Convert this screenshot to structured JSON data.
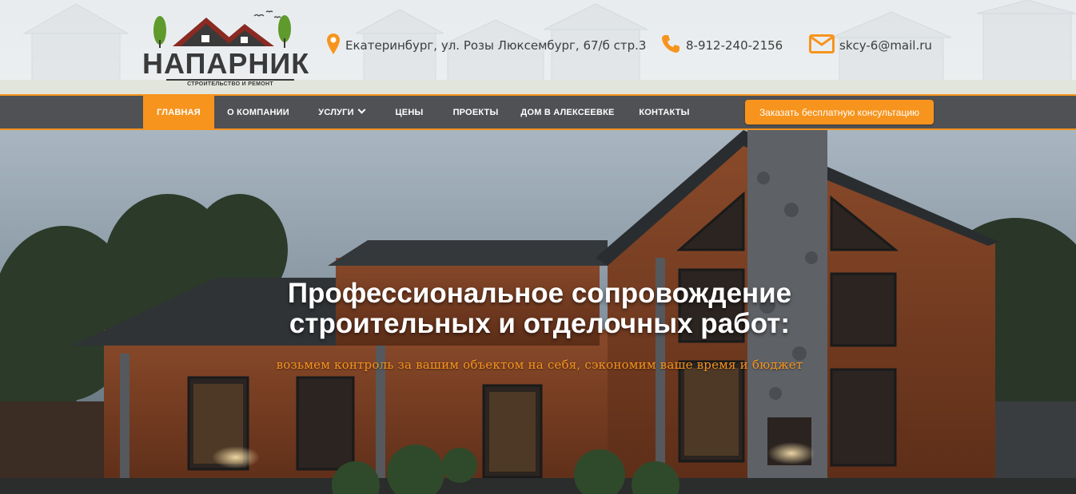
{
  "brand": {
    "name": "НАПАРНИК",
    "tagline": "СТРОИТЕЛЬСТВО И РЕМОНТ"
  },
  "contacts": {
    "address": "Екатеринбург, ул. Розы Люксембург, 67/б стр.3",
    "phone": "8-912-240-2156",
    "email": "skcy-6@mail.ru",
    "icons": {
      "address": "map-pin-icon",
      "phone": "phone-icon",
      "email": "envelope-icon"
    }
  },
  "nav": {
    "items": [
      {
        "label": "ГЛАВНАЯ",
        "active": true
      },
      {
        "label": "О КОМПАНИИ"
      },
      {
        "label": "УСЛУГИ",
        "dropdown": true
      },
      {
        "label": "ЦЕНЫ"
      },
      {
        "label": "ПРОЕКТЫ"
      },
      {
        "label": "ДОМ В АЛЕКСЕЕВКЕ"
      },
      {
        "label": "КОНТАКТЫ"
      }
    ],
    "cta_label": "Заказать бесплатную консультацию"
  },
  "hero": {
    "title_line1": "Профессиональное сопровождение",
    "title_line2": "строительных и отделочных работ:",
    "subtitle": "возьмем контроль за вашим объектом на себя, сэкономим ваше время и бюджет"
  },
  "colors": {
    "accent": "#f7941d",
    "nav_bg": "#4f5154",
    "text_dark": "#3d3d3d"
  }
}
